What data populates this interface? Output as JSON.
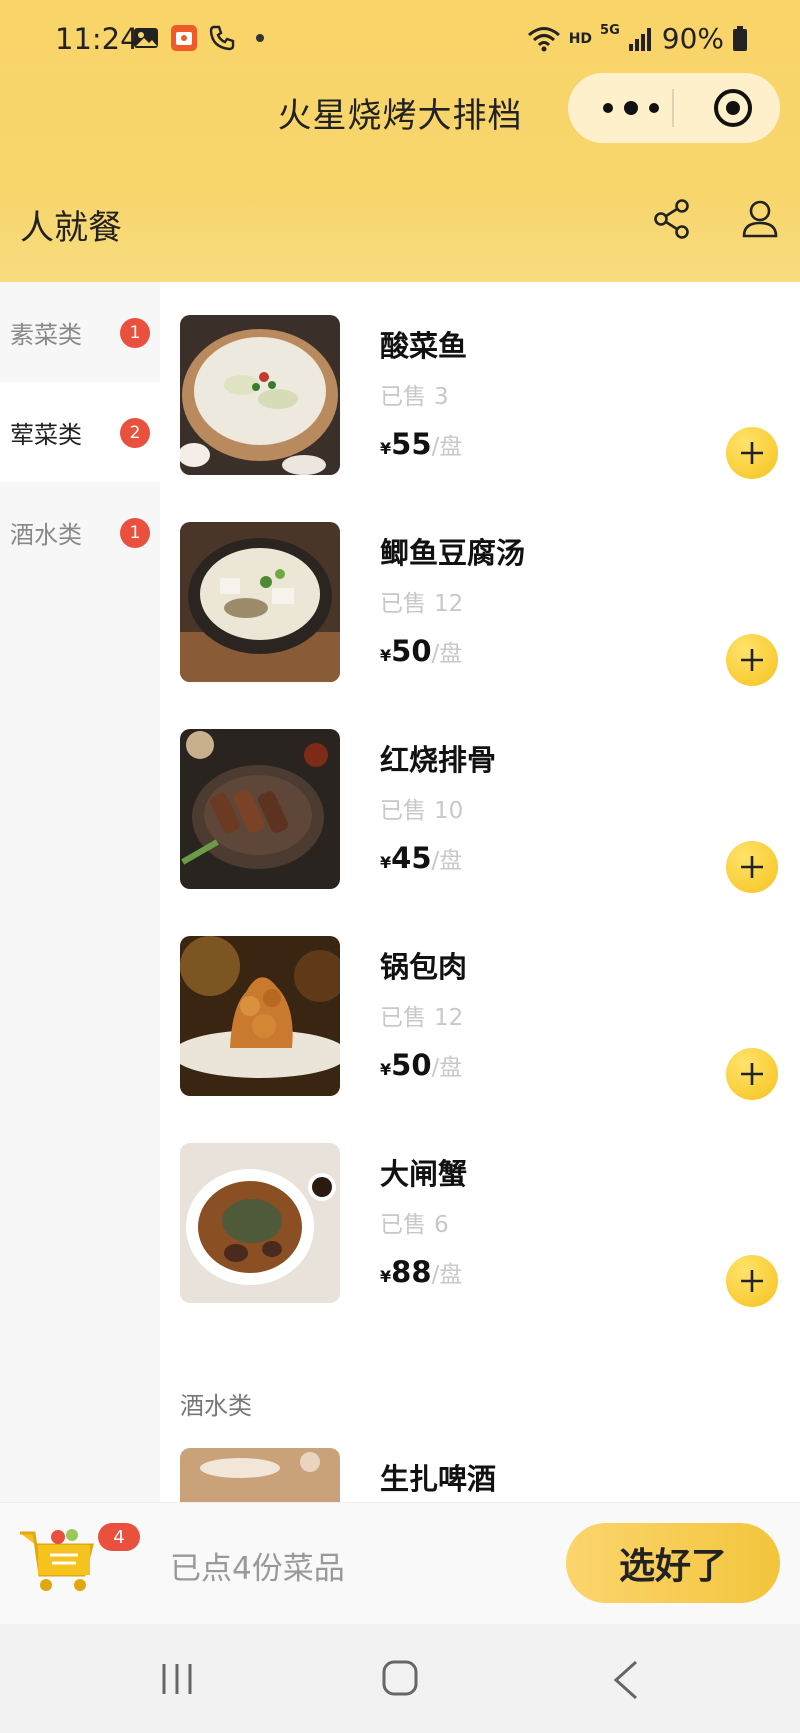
{
  "status_bar": {
    "time": "11:24",
    "hd_label": "HD",
    "net_label": "5G",
    "battery": "90%"
  },
  "header": {
    "title": "火星烧烤大排档",
    "subtitle": "人就餐"
  },
  "sidebar": {
    "categories": [
      {
        "label": "素菜类",
        "count": "1"
      },
      {
        "label": "荤菜类",
        "count": "2"
      },
      {
        "label": "酒水类",
        "count": "1"
      }
    ]
  },
  "menu": {
    "sold_label": "已售",
    "currency": "¥",
    "unit": "/盘",
    "items": [
      {
        "name": "酸菜鱼",
        "sold": "3",
        "price": "55"
      },
      {
        "name": "鲫鱼豆腐汤",
        "sold": "12",
        "price": "50"
      },
      {
        "name": "红烧排骨",
        "sold": "10",
        "price": "45"
      },
      {
        "name": "锅包肉",
        "sold": "12",
        "price": "50"
      },
      {
        "name": "大闸蟹",
        "sold": "6",
        "price": "88"
      }
    ],
    "section_title": "酒水类",
    "drink_item": {
      "name": "生扎啤酒"
    }
  },
  "bottom_bar": {
    "cart_count": "4",
    "ordered_text": "已点4份菜品",
    "done_label": "选好了"
  },
  "colors": {
    "header_bg": "#f8d66d",
    "accent_yellow": "#f6c21e",
    "badge_red": "#e9513e"
  }
}
